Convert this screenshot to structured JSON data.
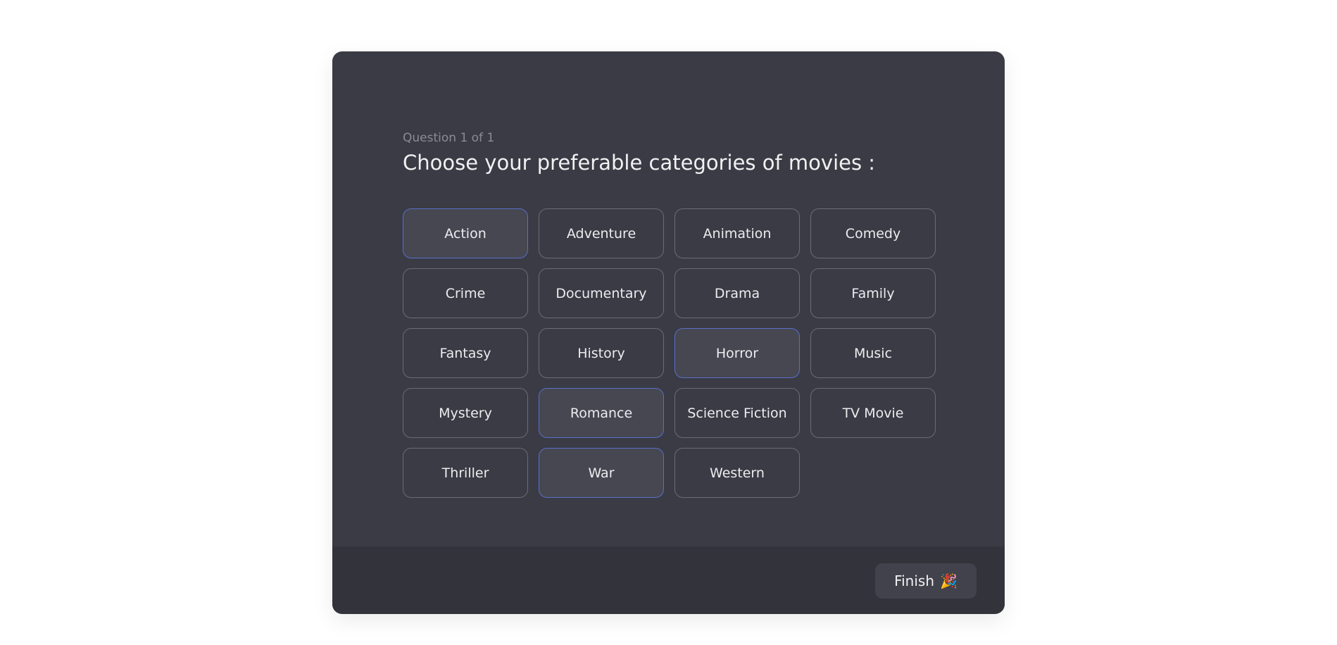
{
  "question": {
    "counter": "Question 1 of 1",
    "title": "Choose your preferable categories of movies :"
  },
  "options": [
    {
      "label": "Action",
      "selected": true
    },
    {
      "label": "Adventure",
      "selected": false
    },
    {
      "label": "Animation",
      "selected": false
    },
    {
      "label": "Comedy",
      "selected": false
    },
    {
      "label": "Crime",
      "selected": false
    },
    {
      "label": "Documentary",
      "selected": false
    },
    {
      "label": "Drama",
      "selected": false
    },
    {
      "label": "Family",
      "selected": false
    },
    {
      "label": "Fantasy",
      "selected": false
    },
    {
      "label": "History",
      "selected": false
    },
    {
      "label": "Horror",
      "selected": true
    },
    {
      "label": "Music",
      "selected": false
    },
    {
      "label": "Mystery",
      "selected": false
    },
    {
      "label": "Romance",
      "selected": true
    },
    {
      "label": "Science Fiction",
      "selected": false
    },
    {
      "label": "TV Movie",
      "selected": false
    },
    {
      "label": "Thriller",
      "selected": false
    },
    {
      "label": "War",
      "selected": true
    },
    {
      "label": "Western",
      "selected": false
    }
  ],
  "footer": {
    "finish_label": "Finish",
    "finish_icon": "🎉",
    "finish_icon_name": "party-popper-icon"
  },
  "colors": {
    "card_bg": "#3a3b44",
    "footer_bg": "#33343b",
    "selected_border": "#5a6fc8",
    "option_border": "#6b6c75"
  }
}
